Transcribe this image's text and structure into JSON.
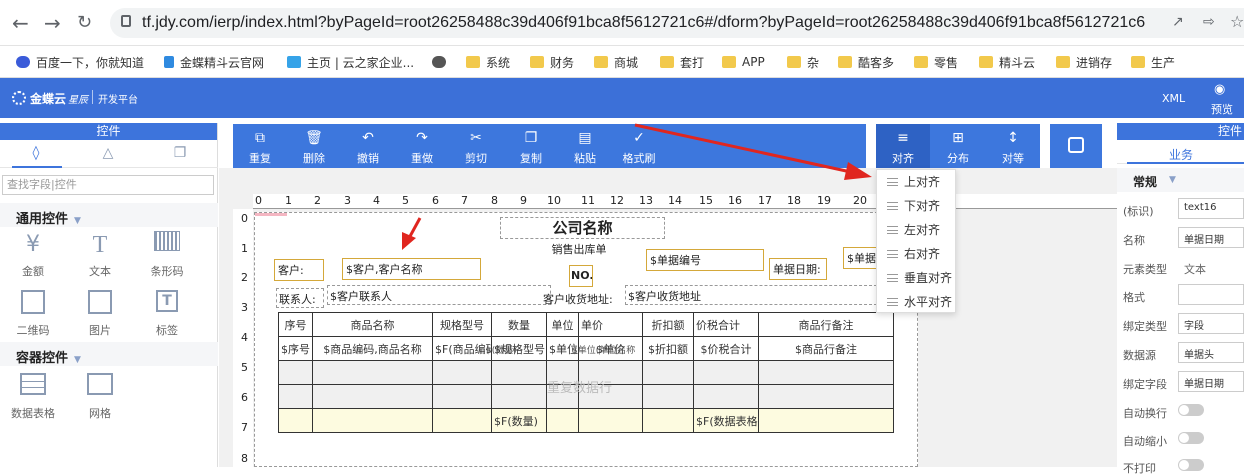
{
  "browser": {
    "url": "tf.jdy.com/ierp/index.html?byPageId=root26258488c39d406f91bca8f5612721c6#/dform?byPageId=root26258488c39d406f91bca8f5612721c6",
    "icons": [
      "back-icon",
      "forward-icon",
      "reload-icon",
      "lock-icon",
      "share-icon",
      "star-icon"
    ],
    "bookmarks": [
      "百度一下，你就知道",
      "金蝶精斗云官网",
      "主页 | 云之家企业...",
      "",
      "系统",
      "财务",
      "商城",
      "套打",
      "APP",
      "杂",
      "酷客多",
      "零售",
      "精斗云",
      "进销存",
      "生产"
    ]
  },
  "app": {
    "logo": "金蝶云",
    "logo_sub": "星辰",
    "platform": "开发平台",
    "xml_label": "XML",
    "preview_label": "预览",
    "accent": "#3c70d8"
  },
  "left": {
    "title": "控件",
    "search_placeholder": "查找字段|控件",
    "section_common": "通用控件",
    "section_container": "容器控件",
    "tools": [
      "金额",
      "文本",
      "条形码",
      "二维码",
      "图片",
      "标签"
    ],
    "container_tools": [
      "数据表格",
      "网格"
    ]
  },
  "toolbar": {
    "buttons": [
      "重复",
      "删除",
      "撤销",
      "重做",
      "剪切",
      "复制",
      "粘贴",
      "格式刷"
    ],
    "align_buttons": [
      "对齐",
      "分布",
      "对等"
    ]
  },
  "dropdown": {
    "items": [
      "上对齐",
      "下对齐",
      "左对齐",
      "右对齐",
      "垂直对齐",
      "水平对齐"
    ]
  },
  "ruler": {
    "h": [
      "0",
      "1",
      "2",
      "3",
      "4",
      "5",
      "6",
      "7",
      "8",
      "9",
      "10",
      "11",
      "12",
      "13",
      "14",
      "15",
      "16",
      "17",
      "18",
      "19",
      "20"
    ],
    "v": [
      "0",
      "1",
      "2",
      "3",
      "4",
      "5",
      "6",
      "7",
      "8"
    ]
  },
  "canvas": {
    "company": "公司名称",
    "doc_type": "销售出库单",
    "no_label": "NO.",
    "bill_no": "$单据编号",
    "bill_date_label": "单据日期:",
    "bill_date_value": "$单据",
    "customer_label": "客户:",
    "customer_value": "$客户,客户名称",
    "contact_label": "联系人:",
    "contact_value": "$客户联系人",
    "address_label": "客户收货地址:",
    "address_value": "$客户收货地址",
    "table_header": [
      "序号",
      "商品名称",
      "规格型号",
      "数量",
      "单位",
      "单价",
      "折扣额",
      "价税合计",
      "商品行备注"
    ],
    "table_row": [
      "$序号",
      "$商品编码,商品名称",
      "$F(商品编码)",
      "$规格型号",
      "$单位",
      "$单价",
      "$折扣额",
      "$价税合计",
      "$商品行备注"
    ],
    "row_extra_a": "$(数量)",
    "row_extra_b": "$单位(单位名称)",
    "repeat_label": "重复数据行",
    "sum_qty": "$F(数量)",
    "sum_total": "$F(数据表格合计)"
  },
  "right": {
    "title": "控件",
    "tab": "业务",
    "section": "常规",
    "rows": [
      {
        "label": "(标识)",
        "value": "text16"
      },
      {
        "label": "名称",
        "value": "单据日期"
      },
      {
        "label": "元素类型",
        "value": "文本"
      },
      {
        "label": "格式",
        "value": ""
      },
      {
        "label": "绑定类型",
        "value": "字段"
      },
      {
        "label": "数据源",
        "value": "单据头"
      },
      {
        "label": "绑定字段",
        "value": "单据日期"
      },
      {
        "label": "自动换行",
        "value": ""
      },
      {
        "label": "自动缩小",
        "value": ""
      },
      {
        "label": "不打印",
        "value": ""
      }
    ]
  }
}
